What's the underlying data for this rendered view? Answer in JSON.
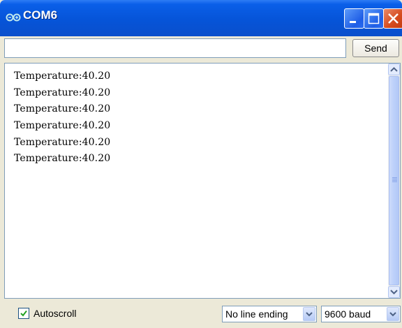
{
  "window": {
    "title": "COM6",
    "icon": "infinity-icon",
    "controls": [
      "minimize-icon",
      "maximize-icon",
      "close-icon"
    ]
  },
  "toolbar": {
    "input_value": "",
    "send_label": "Send"
  },
  "serial_output": {
    "lines": [
      "Temperature:40.20",
      "Temperature:40.20",
      "Temperature:40.20",
      "Temperature:40.20",
      "Temperature:40.20",
      "Temperature:40.20"
    ]
  },
  "status": {
    "autoscroll_label": "Autoscroll",
    "autoscroll_checked": true,
    "line_ending": "No line ending",
    "baud_rate": "9600 baud"
  }
}
